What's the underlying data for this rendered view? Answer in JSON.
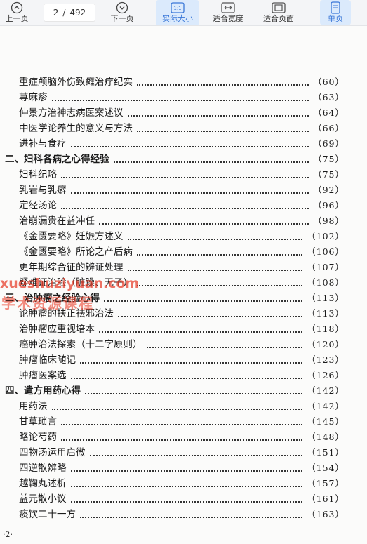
{
  "toolbar": {
    "prev_label": "上一页",
    "page_current": "2",
    "page_sep": "/",
    "page_total": "492",
    "next_label": "下一页",
    "actual_size_label": "实际大小",
    "actual_size_icon_text": "1:1",
    "fit_width_label": "适合宽度",
    "fit_page_label": "适合页面",
    "single_page_label": "单页",
    "active_color": "#3b78d8"
  },
  "toc": [
    {
      "title": "重症颅脑外伤致瘫治疗纪实",
      "page": "（60）",
      "level": "item"
    },
    {
      "title": "荨麻疹",
      "page": "（63）",
      "level": "item"
    },
    {
      "title": "仲景方治神志病医案述议",
      "page": "（64）",
      "level": "item"
    },
    {
      "title": "中医学论养生的意义与方法",
      "page": "（66）",
      "level": "item"
    },
    {
      "title": "进补与食疗",
      "page": "（69）",
      "level": "item"
    },
    {
      "title": "二、妇科各病之心得经验",
      "page": "（75）",
      "level": "section"
    },
    {
      "title": "妇科纪略",
      "page": "（75）",
      "level": "item"
    },
    {
      "title": "乳岩与乳癖",
      "page": "（92）",
      "level": "item"
    },
    {
      "title": "定经汤论",
      "page": "（96）",
      "level": "item"
    },
    {
      "title": "治崩漏贵在益冲任",
      "page": "（98）",
      "level": "item"
    },
    {
      "title": "《金匮要略》妊娠方述义",
      "page": "（102）",
      "level": "item"
    },
    {
      "title": "《金匮要略》所论之产后病",
      "page": "（106）",
      "level": "item"
    },
    {
      "title": "更年期综合征的辨证处理",
      "page": "（107）",
      "level": "item"
    },
    {
      "title": "疑难证治验（脏躁、无子）",
      "page": "（108）",
      "level": "item"
    },
    {
      "title": "三、治肿瘤之经验心得",
      "page": "（113）",
      "level": "section"
    },
    {
      "title": "论肿瘤的扶正祛邪治法",
      "page": "（113）",
      "level": "item"
    },
    {
      "title": "治肿瘤应重视培本",
      "page": "（118）",
      "level": "item"
    },
    {
      "title": "癌肿治法探索（十二字原则）",
      "page": "（120）",
      "level": "item"
    },
    {
      "title": "肿瘤临床随记",
      "page": "（123）",
      "level": "item"
    },
    {
      "title": "肿瘤医案选",
      "page": "（126）",
      "level": "item"
    },
    {
      "title": "四、遣方用药心得",
      "page": "（142）",
      "level": "section"
    },
    {
      "title": "用药法",
      "page": "（142）",
      "level": "item"
    },
    {
      "title": "甘草琐言",
      "page": "（145）",
      "level": "item"
    },
    {
      "title": "略论芍药",
      "page": "（148）",
      "level": "item"
    },
    {
      "title": "四物汤运用启微",
      "page": "（151）",
      "level": "item"
    },
    {
      "title": "四逆散辨略",
      "page": "（154）",
      "level": "item"
    },
    {
      "title": "越鞠丸述析",
      "page": "（157）",
      "level": "item"
    },
    {
      "title": "益元散小议",
      "page": "（161）",
      "level": "item"
    },
    {
      "title": "痰饮二十一方",
      "page": "（163）",
      "level": "item"
    }
  ],
  "watermark": {
    "line1": "xueshuziyuan.com",
    "line2": "学术资源课程"
  },
  "footer": {
    "page_number": "·2·"
  }
}
